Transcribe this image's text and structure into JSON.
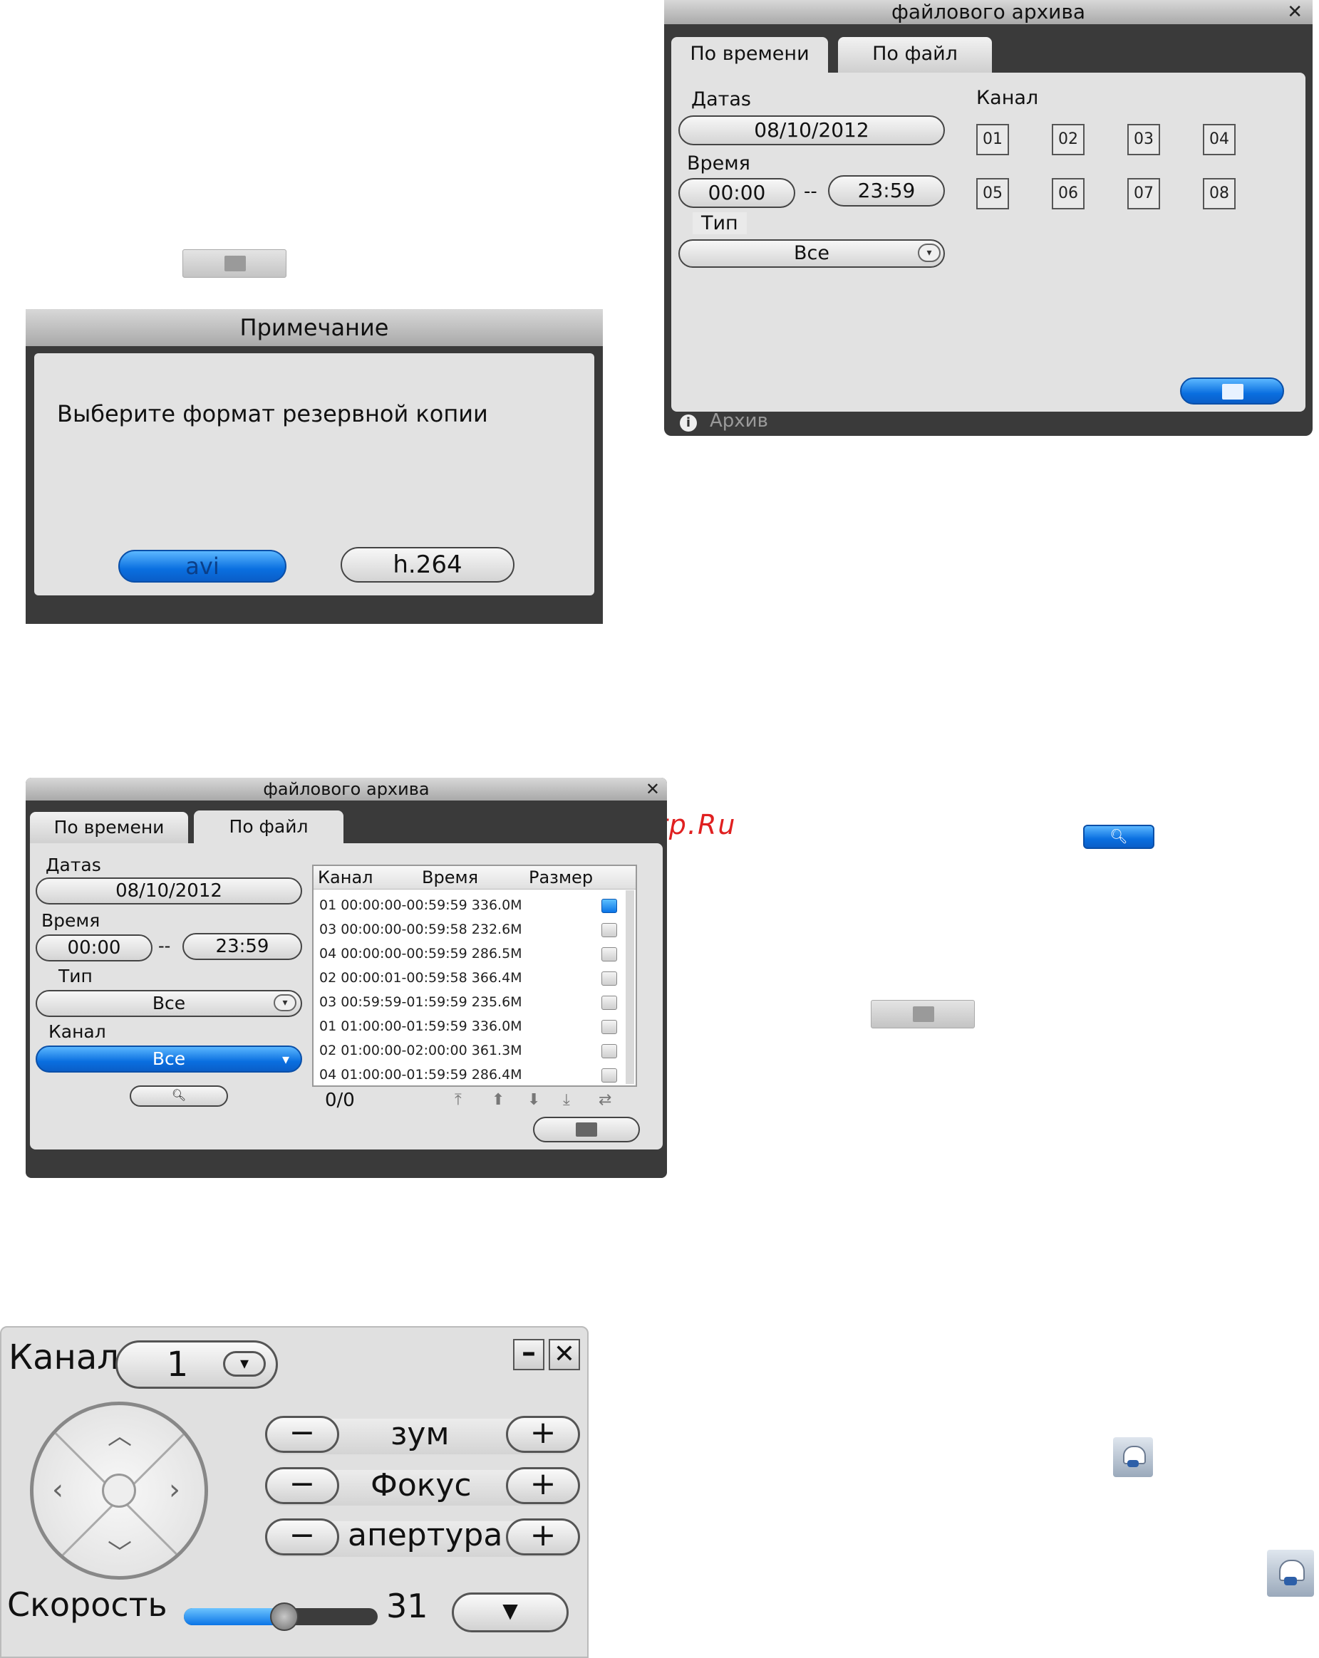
{
  "watermark": "McGrp.Ru",
  "note_dialog": {
    "title": "Примечание",
    "message": "Выберите формат резервной копии",
    "avi_label": "avi",
    "h264_label": "h.264"
  },
  "archive_time": {
    "title": "файлового архива",
    "tabs": [
      "По времени",
      "По файл"
    ],
    "date_label": "Датаs",
    "date_value": "08/10/2012",
    "time_label": "Время",
    "time_from": "00:00",
    "time_sep": "--",
    "time_to": "23:59",
    "type_label": "Тип",
    "type_value": "Все",
    "channel_label": "Канал",
    "channels": [
      "01",
      "02",
      "03",
      "04",
      "05",
      "06",
      "07",
      "08"
    ],
    "status_text": "Архив"
  },
  "archive_file": {
    "title": "файлового архива",
    "tabs": [
      "По времени",
      "По файл"
    ],
    "date_label": "Датаs",
    "date_value": "08/10/2012",
    "time_label": "Время",
    "time_from": "00:00",
    "time_sep": "--",
    "time_to": "23:59",
    "type_label": "Тип",
    "type_value": "Все",
    "channel_label": "Канал",
    "channel_value": "Все",
    "columns": [
      "Канал",
      "Время",
      "Размер"
    ],
    "rows": [
      {
        "text": "01 00:00:00-00:59:59 336.0M",
        "checked": true
      },
      {
        "text": "03 00:00:00-00:59:58 232.6M",
        "checked": false
      },
      {
        "text": "04 00:00:00-00:59:59 286.5M",
        "checked": false
      },
      {
        "text": "02 00:00:01-00:59:58 366.4M",
        "checked": false
      },
      {
        "text": "03 00:59:59-01:59:59 235.6M",
        "checked": false
      },
      {
        "text": "01 01:00:00-01:59:59 336.0M",
        "checked": false
      },
      {
        "text": "02 01:00:00-02:00:00 361.3M",
        "checked": false
      },
      {
        "text": "04 01:00:00-01:59:59 286.4M",
        "checked": false
      }
    ],
    "count": "0/0"
  },
  "ptz": {
    "channel_label": "Канал",
    "channel_value": "1",
    "zoom_label": "зум",
    "focus_label": "Фокус",
    "aperture_label": "апертура",
    "speed_label": "Скорость",
    "speed_value": "31",
    "speed_level": 0.52
  }
}
